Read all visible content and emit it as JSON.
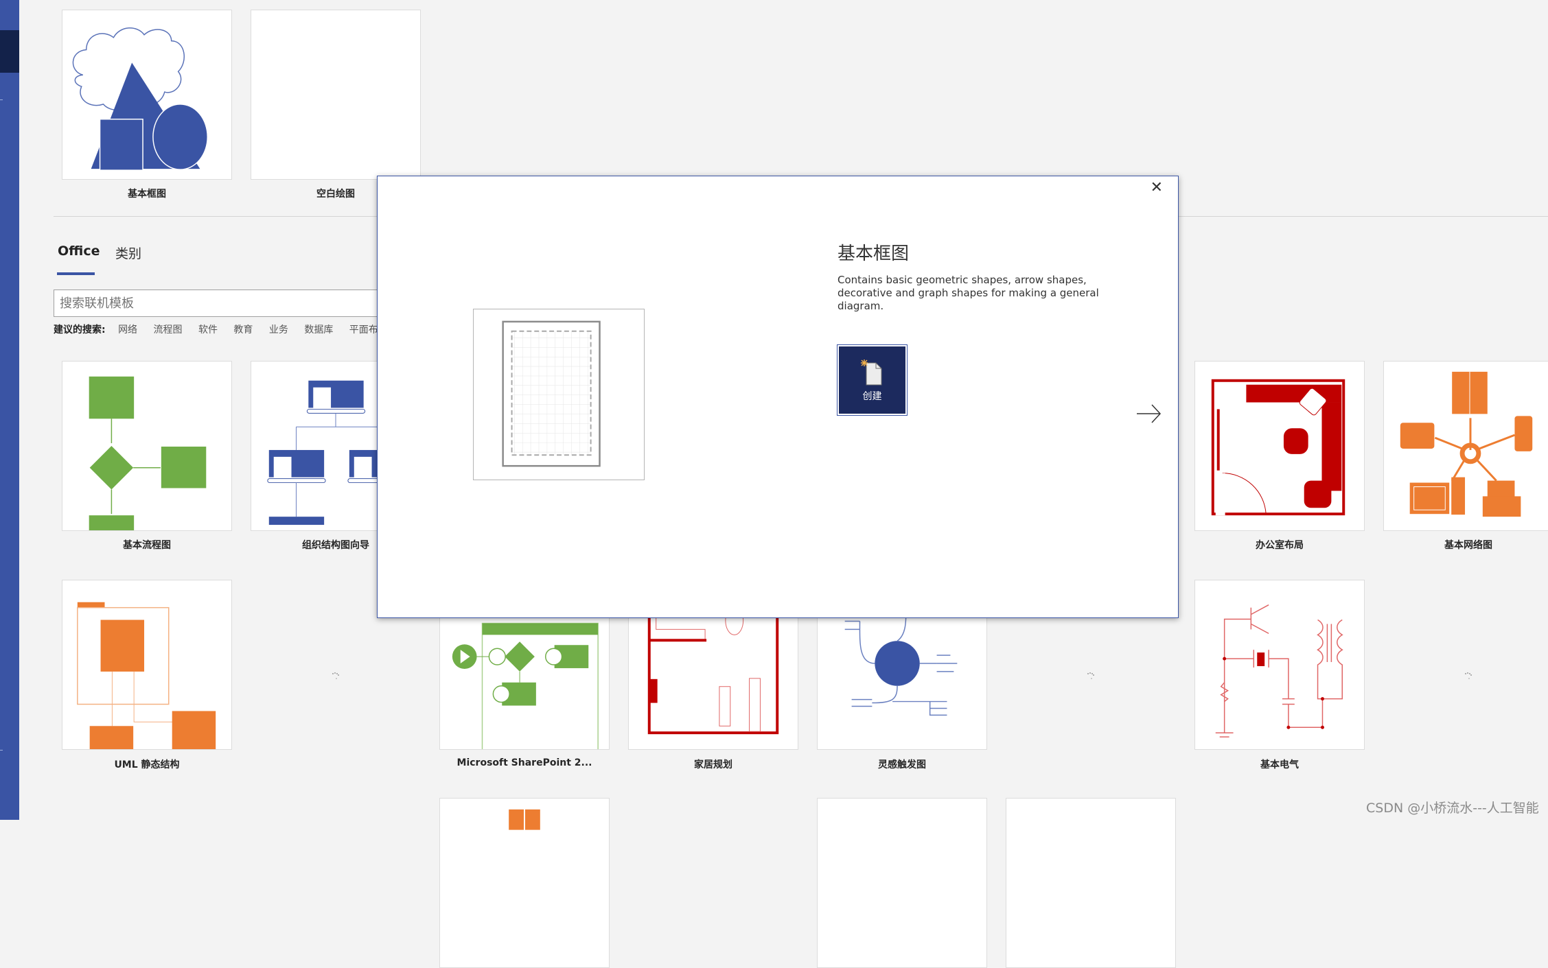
{
  "featured_templates": [
    {
      "label": "基本框图",
      "thumbnail": "basic-shapes"
    },
    {
      "label": "空白绘图",
      "thumbnail": "blank"
    }
  ],
  "tabs": [
    {
      "label": "Office",
      "active": true
    },
    {
      "label": "类别",
      "active": false
    }
  ],
  "search": {
    "placeholder": "搜索联机模板",
    "value": ""
  },
  "suggested_searches": {
    "label": "建议的搜索:",
    "items": [
      "网络",
      "流程图",
      "软件",
      "教育",
      "业务",
      "数据库",
      "平面布置图"
    ]
  },
  "templates_row1": [
    {
      "label": "基本流程图",
      "thumbnail": "flowchart",
      "loaded": true
    },
    {
      "label": "组织结构图向导",
      "thumbnail": "org-chart",
      "loaded": true
    },
    {
      "label": "办公室布局",
      "thumbnail": "office-layout",
      "loaded": true
    },
    {
      "label": "基本网络图",
      "thumbnail": "network",
      "loaded": true
    }
  ],
  "templates_row2": [
    {
      "label": "UML 静态结构",
      "thumbnail": "uml",
      "loaded": true
    },
    {
      "label": "",
      "thumbnail": "loading",
      "loaded": false
    },
    {
      "label": "Microsoft SharePoint 2...",
      "thumbnail": "sharepoint-workflow",
      "loaded": true
    },
    {
      "label": "家居规划",
      "thumbnail": "home-plan",
      "loaded": true
    },
    {
      "label": "灵感触发图",
      "thumbnail": "brainstorm",
      "loaded": true
    },
    {
      "label": "",
      "thumbnail": "loading",
      "loaded": false
    },
    {
      "label": "基本电气",
      "thumbnail": "electrical",
      "loaded": true
    },
    {
      "label": "",
      "thumbnail": "loading",
      "loaded": false
    }
  ],
  "dialog": {
    "title": "基本框图",
    "description": "Contains basic geometric shapes, arrow shapes, decorative and graph shapes for making a general diagram.",
    "create_label": "创建",
    "close_icon": "close-icon",
    "next_icon": "arrow-right-icon"
  },
  "colors": {
    "sidebar": "#3a54a4",
    "sidebar_active": "#13224a",
    "create_button": "#1c2a5e",
    "green": "#70ad47",
    "orange": "#ed7d31",
    "red": "#c00000",
    "blue": "#3a54a4"
  },
  "watermark": "CSDN @小桥流水---人工智能"
}
